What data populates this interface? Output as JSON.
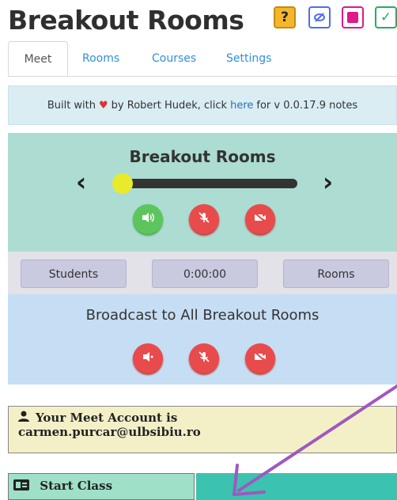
{
  "app": {
    "title": "Breakout Rooms"
  },
  "top_icons": [
    {
      "name": "help-icon",
      "glyph": "?",
      "color": "#f0a820"
    },
    {
      "name": "hide-icon",
      "glyph": "◌",
      "color": "#4f6df0"
    },
    {
      "name": "notes-icon",
      "glyph": "■",
      "color": "#e0188c"
    },
    {
      "name": "check-icon",
      "glyph": "✓",
      "color": "#20b060"
    }
  ],
  "tabs": [
    {
      "label": "Meet",
      "active": true
    },
    {
      "label": "Rooms",
      "active": false
    },
    {
      "label": "Courses",
      "active": false
    },
    {
      "label": "Settings",
      "active": false
    }
  ],
  "notes": {
    "prefix": "Built with",
    "author_text": "by Robert Hudek, click",
    "link_text": "here",
    "suffix": "for v 0.0.17.9 notes"
  },
  "breakout_panel": {
    "title": "Breakout Rooms",
    "prev_label": "‹",
    "next_label": "›",
    "slider_level": 0
  },
  "info_bar": {
    "students_label": "Students",
    "timer": "0:00:00",
    "rooms_label": "Rooms"
  },
  "broadcast": {
    "title": "Broadcast to All Breakout Rooms"
  },
  "account": {
    "label": "Your Meet Account is",
    "email": "carmen.purcar@ulbsibiu.ro"
  },
  "start": {
    "label": "Start Class"
  },
  "colors": {
    "accent_blue": "#2f8fe0",
    "green_panel": "#acdcd2",
    "blue_panel": "#c6def4",
    "red_button": "#e84b4b",
    "green_button": "#5cc65c",
    "annotation_arrow": "#a058c0"
  }
}
